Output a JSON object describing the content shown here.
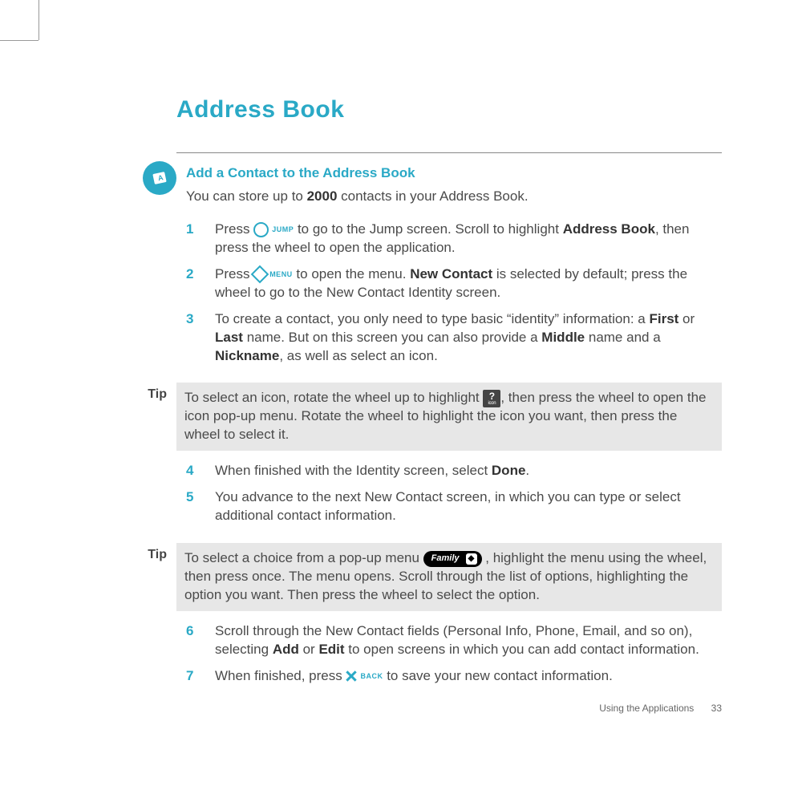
{
  "title": "Address Book",
  "section_heading": "Add a Contact to the Address Book",
  "intro": {
    "pre": "You can store up to ",
    "bold": "2000",
    "post": " contacts in your Address Book."
  },
  "keys": {
    "jump": "JUMP",
    "menu": "MENU",
    "back": "BACK"
  },
  "steps": {
    "s1": {
      "num": "1",
      "a": "Press ",
      "b": " to go to the Jump screen. Scroll to highlight ",
      "bold1": "Address Book",
      "c": ", then press the wheel to open the application."
    },
    "s2": {
      "num": "2",
      "a": "Press ",
      "b": " to open the menu. ",
      "bold1": "New Contact",
      "c": " is selected by default; press the wheel to go to the New Contact Identity screen."
    },
    "s3": {
      "num": "3",
      "a": "To create a contact, you only need to type basic “identity” information: a ",
      "bold1": "First",
      "b": " or ",
      "bold2": "Last",
      "c": " name. But on this screen you can also provide a ",
      "bold3": "Middle",
      "d": " name and a ",
      "bold4": "Nickname",
      "e": ", as well as select an icon."
    },
    "s4": {
      "num": "4",
      "a": "When finished with the Identity screen, select ",
      "bold1": "Done",
      "b": "."
    },
    "s5": {
      "num": "5",
      "a": "You advance to the next New Contact screen, in which you can type or select additional contact information."
    },
    "s6": {
      "num": "6",
      "a": "Scroll through the New Contact fields (Personal Info, Phone, Email, and so on), selecting ",
      "bold1": "Add",
      "b": " or ",
      "bold2": "Edit",
      "c": " to open screens in which you can add contact information."
    },
    "s7": {
      "num": "7",
      "a": "When finished, press ",
      "b": " to save your new contact information."
    }
  },
  "tips": {
    "label": "Tip",
    "t1": {
      "a": "To select an icon, rotate the wheel up to highlight ",
      "b": ", then press the wheel to open the icon pop-up menu. Rotate the wheel to highlight the icon you want, then press the wheel to select it."
    },
    "t2": {
      "a": "To select a choice from a pop-up menu ",
      "b": " , highlight the menu using the wheel, then press once. The menu opens. Scroll through the list of options, highlighting the option you want. Then press the wheel to select the option."
    }
  },
  "popup_example": "Family",
  "qicon": {
    "top": "?",
    "bottom": "icon"
  },
  "footer": {
    "section": "Using the Applications",
    "page": "33"
  }
}
